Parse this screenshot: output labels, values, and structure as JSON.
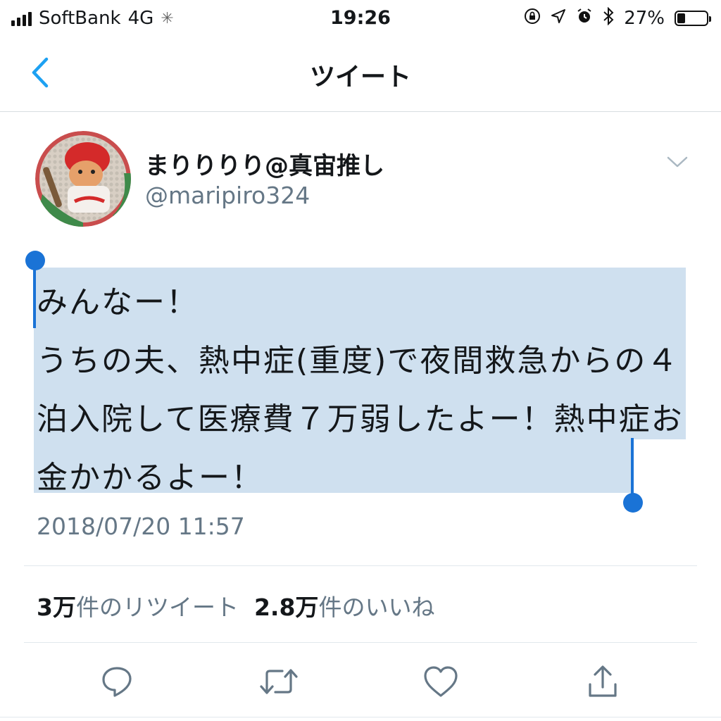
{
  "status_bar": {
    "carrier": "SoftBank",
    "network": "4G",
    "time": "19:26",
    "battery": "27%",
    "battery_level": 0.27
  },
  "nav": {
    "title": "ツイート"
  },
  "tweet": {
    "display_name": "まりりりり@真宙推し",
    "handle": "@maripiro324",
    "text": "みんなー！\nうちの夫、熱中症(重度)で夜間救急からの４泊入院して医療費７万弱したよー！熱中症お金かかるよー！",
    "timestamp": "2018/07/20 11:57"
  },
  "stats": {
    "retweets_count": "3万",
    "retweets_label": "件のリツイート",
    "likes_count": "2.8万",
    "likes_label": "件のいいね"
  },
  "colors": {
    "accent": "#1da1f2",
    "selection": "#cfe0ef",
    "selection_handle": "#1a73d6",
    "secondary_text": "#657786"
  },
  "icons": [
    "back-chevron-icon",
    "dropdown-chevron-icon",
    "reply-icon",
    "retweet-icon",
    "like-icon",
    "share-icon"
  ]
}
